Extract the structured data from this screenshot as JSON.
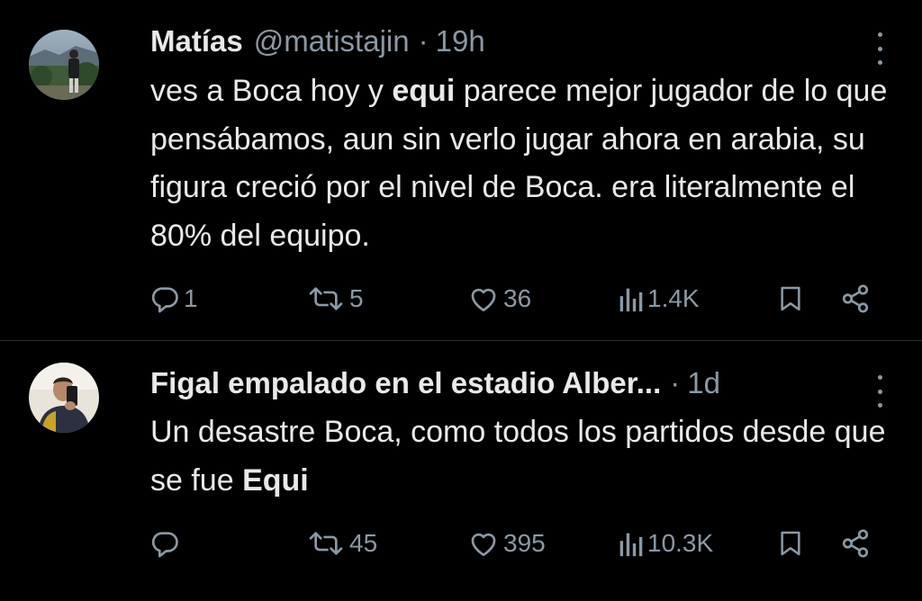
{
  "tweets": [
    {
      "name": "Matías",
      "handle": "@matistajin",
      "separator": "·",
      "time": "19h",
      "text_parts": [
        "ves a Boca hoy y ",
        "equi",
        " parece mejor jugador de lo que pensábamos, aun sin verlo jugar ahora en arabia, su figura creció por el nivel de Boca. era literalmente el 80% del equipo."
      ],
      "replies": "1",
      "retweets": "5",
      "likes": "36",
      "views": "1.4K"
    },
    {
      "name": "Figal empalado en el estadio Alber...",
      "handle": "",
      "separator": "·",
      "time": "1d",
      "text_parts": [
        "Un desastre Boca, como todos los partidos desde que se fue ",
        "Equi",
        ""
      ],
      "replies": "",
      "retweets": "45",
      "likes": "395",
      "views": "10.3K"
    }
  ],
  "icons": {
    "reply": "reply-icon",
    "retweet": "retweet-icon",
    "like": "heart-icon",
    "views": "views-icon",
    "bookmark": "bookmark-icon",
    "share": "share-icon",
    "more": "more-icon"
  },
  "colors": {
    "background": "#000000",
    "text": "#e7e9ea",
    "secondary": "#8b98a5",
    "divider": "#2f3336"
  }
}
